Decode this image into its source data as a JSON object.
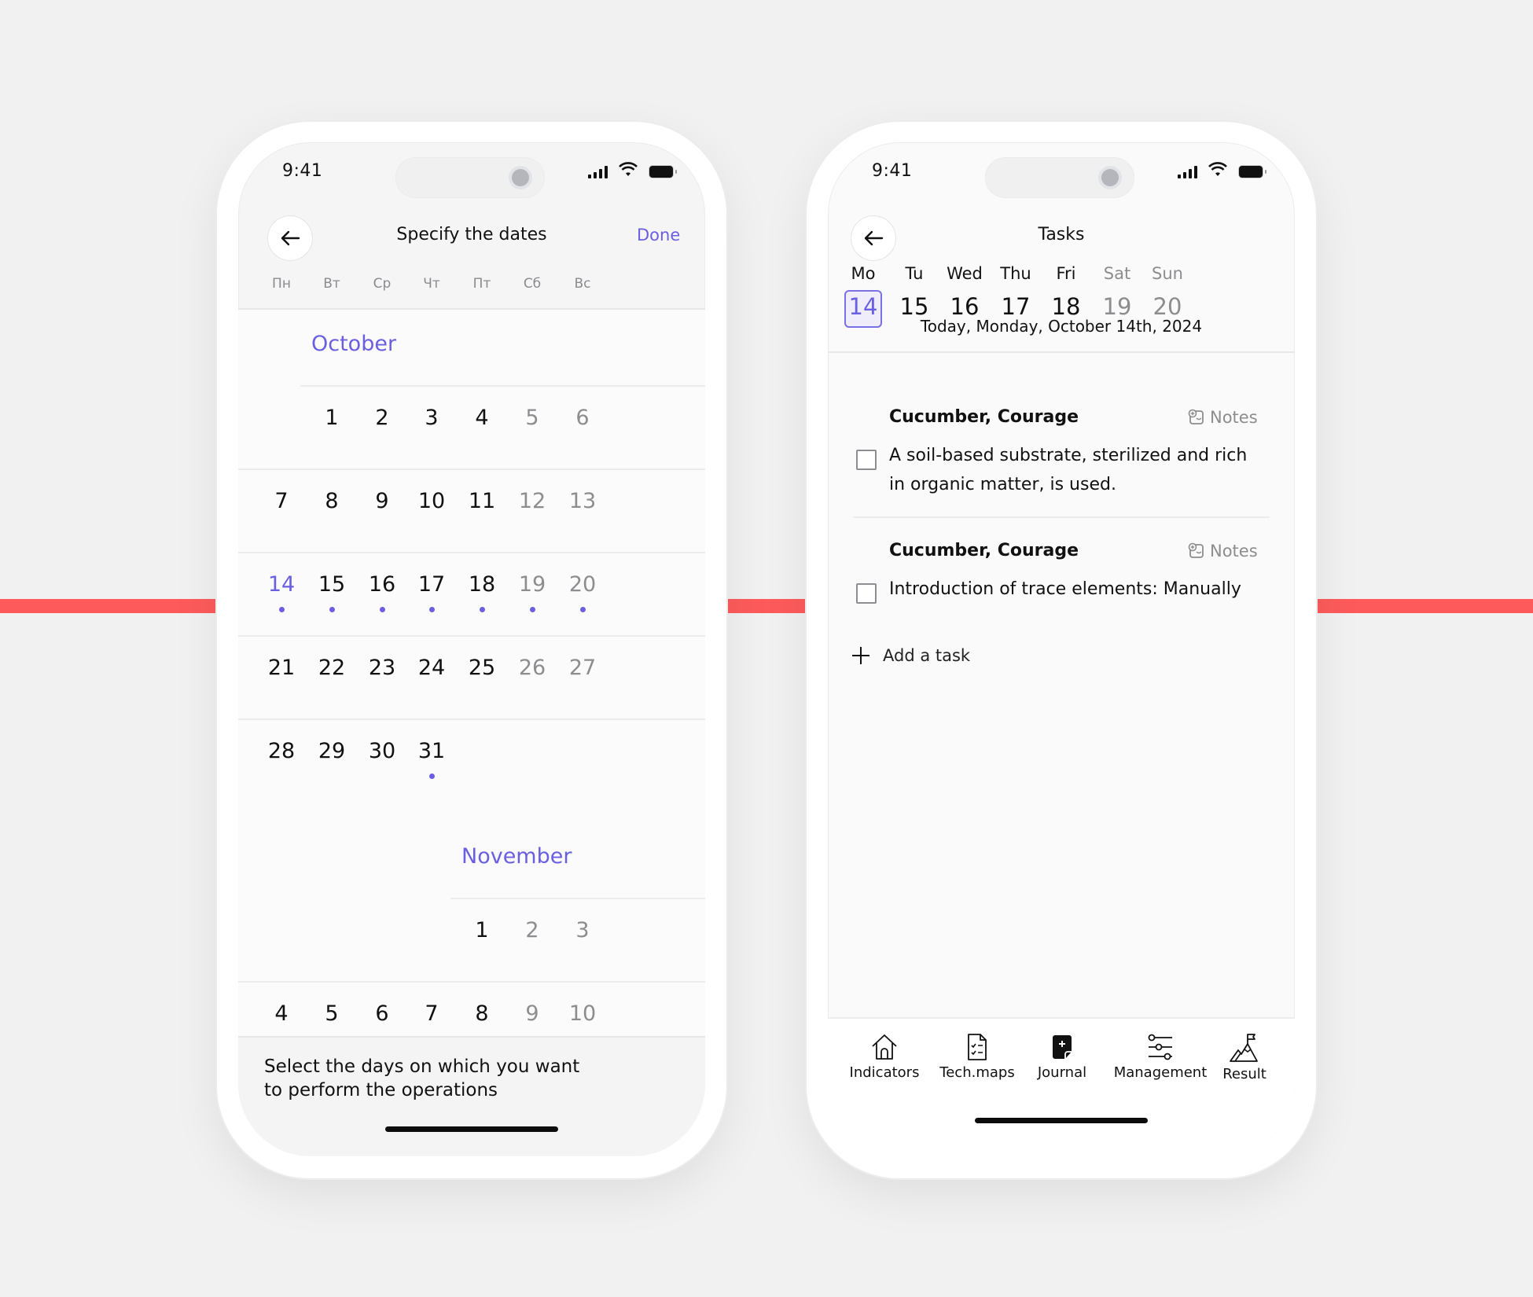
{
  "status_bar": {
    "time": "9:41"
  },
  "left_screen": {
    "header": {
      "title": "Specify the dates",
      "done_label": "Done",
      "back_icon": "arrow-left-icon"
    },
    "weekdays": [
      "Пн",
      "Вт",
      "Ср",
      "Чт",
      "Пт",
      "Сб",
      "Вс"
    ],
    "months": [
      {
        "name": "October",
        "weeks": [
          [
            null,
            "1",
            "2",
            "3",
            "4",
            "5",
            "6"
          ],
          [
            "7",
            "8",
            "9",
            "10",
            "11",
            "12",
            "13"
          ],
          [
            "14",
            "15",
            "16",
            "17",
            "18",
            "19",
            "20"
          ],
          [
            "21",
            "22",
            "23",
            "24",
            "25",
            "26",
            "27"
          ],
          [
            "28",
            "29",
            "30",
            "31",
            null,
            null,
            null
          ]
        ],
        "today": "14",
        "marked_days": [
          "14",
          "15",
          "16",
          "17",
          "18",
          "19",
          "20",
          "31"
        ]
      },
      {
        "name": "November",
        "weeks": [
          [
            null,
            null,
            null,
            null,
            "1",
            "2",
            "3"
          ],
          [
            "4",
            "5",
            "6",
            "7",
            "8",
            "9",
            "10"
          ]
        ],
        "today": null,
        "marked_days": []
      }
    ],
    "footer_text": "Select the days on which you want to perform the operations",
    "footer_lines": [
      "Select the days on which you want",
      "to perform the operations"
    ]
  },
  "right_screen": {
    "header": {
      "title": "Tasks",
      "back_icon": "arrow-left-icon"
    },
    "week": [
      {
        "label": "Mo",
        "date": "14",
        "today": true,
        "weekend": false
      },
      {
        "label": "Tu",
        "date": "15",
        "today": false,
        "weekend": false
      },
      {
        "label": "Wed",
        "date": "16",
        "today": false,
        "weekend": false
      },
      {
        "label": "Thu",
        "date": "17",
        "today": false,
        "weekend": false
      },
      {
        "label": "Fri",
        "date": "18",
        "today": false,
        "weekend": false
      },
      {
        "label": "Sat",
        "date": "19",
        "today": false,
        "weekend": true
      },
      {
        "label": "Sun",
        "date": "20",
        "today": false,
        "weekend": true
      }
    ],
    "today_label": "Today, Monday, October 14th, 2024",
    "tasks": [
      {
        "title": "Cucumber, Courage",
        "notes_label": "Notes",
        "text_lines": [
          "A soil-based substrate, sterilized and rich",
          "in organic matter, is used."
        ],
        "checked": false
      },
      {
        "title": "Cucumber, Courage",
        "notes_label": "Notes",
        "text_lines": [
          "Introduction of trace elements: Manually"
        ],
        "checked": false
      }
    ],
    "add_task_label": "Add a task",
    "nav": [
      {
        "label": "Indicators",
        "icon": "home-icon",
        "active": false
      },
      {
        "label": "Tech.maps",
        "icon": "checklist-document-icon",
        "active": false
      },
      {
        "label": "Journal",
        "icon": "journal-add-icon",
        "active": true
      },
      {
        "label": "Management",
        "icon": "sliders-icon",
        "active": false
      },
      {
        "label": "Result",
        "icon": "mountain-flag-icon",
        "active": false
      }
    ]
  },
  "colors": {
    "accent": "#6a5fe0",
    "decor_line": "#fd5b5b",
    "muted": "#8d8d90"
  }
}
